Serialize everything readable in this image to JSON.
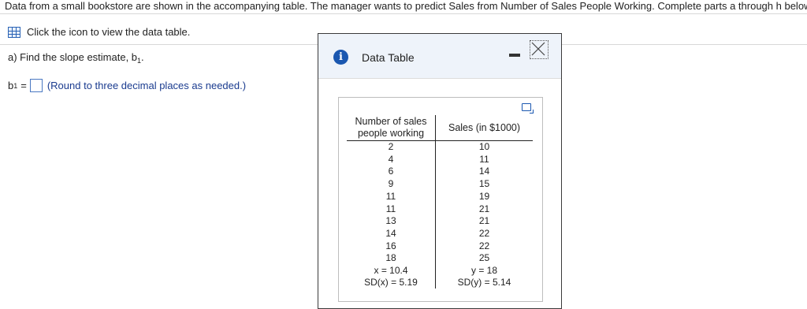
{
  "intro": "Data from a small bookstore are shown in the accompanying table. The manager wants to predict Sales from Number of Sales People Working. Complete parts a through h below.",
  "icon_link_text": "Click the icon to view the data table.",
  "question": {
    "prefix": "a) Find the slope estimate, b",
    "sub": "1",
    "suffix": "."
  },
  "answer": {
    "label": "b",
    "sub": "1",
    "eq": "=",
    "hint": "(Round to three decimal places as needed.)"
  },
  "dialog": {
    "title": "Data Table",
    "headers": [
      "Number of sales people working",
      "Sales (in $1000)"
    ],
    "rows": [
      [
        "2",
        "10"
      ],
      [
        "4",
        "11"
      ],
      [
        "6",
        "14"
      ],
      [
        "9",
        "15"
      ],
      [
        "11",
        "19"
      ],
      [
        "11",
        "21"
      ],
      [
        "13",
        "21"
      ],
      [
        "14",
        "22"
      ],
      [
        "16",
        "22"
      ],
      [
        "18",
        "25"
      ]
    ],
    "mean_x": "x = 10.4",
    "mean_y": "y = 18",
    "sd_x": "SD(x) = 5.19",
    "sd_y": "SD(y) = 5.14"
  },
  "icons": [
    "table-icon",
    "info-icon",
    "minimize-icon",
    "close-icon",
    "copy-icon"
  ],
  "colors": {
    "accent": "#1a57b0",
    "hint": "#1a3b8f"
  }
}
